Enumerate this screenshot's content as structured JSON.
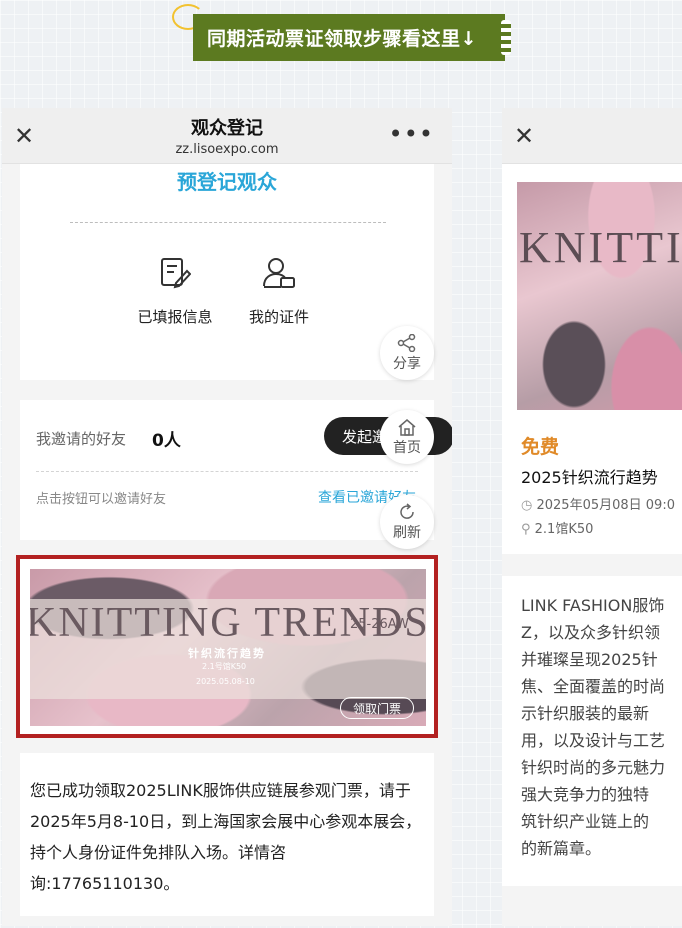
{
  "banner": {
    "text": "同期活动票证领取步骤看这里↓"
  },
  "left_panel": {
    "header": {
      "close": "✕",
      "title": "观众登记",
      "url": "zz.lisoexpo.com",
      "more": "•••"
    },
    "prereg_title": "预登记观众",
    "services": [
      {
        "label": "已填报信息",
        "icon": "form-edit-icon"
      },
      {
        "label": "我的证件",
        "icon": "id-card-icon"
      }
    ],
    "invite": {
      "label": "我邀请的好友",
      "count": "0人",
      "button": "发起邀请",
      "hint": "点击按钮可以邀请好友",
      "link": "查看已邀请好友"
    },
    "float_buttons": [
      {
        "label": "分享",
        "icon": "share-icon"
      },
      {
        "label": "首页",
        "icon": "home-icon"
      },
      {
        "label": "刷新",
        "icon": "refresh-icon"
      }
    ],
    "ticket": {
      "title": "KNITTING TRENDS",
      "season": "25-26AW",
      "cn_title": "针织流行趋势",
      "hall": "2.1号馆K50",
      "date": "2025.05.08-10",
      "button": "领取门票"
    },
    "notice": "您已成功领取2025LINK服饰供应链展参观门票，请于2025年5月8-10日，到上海国家会展中心参观本展会，持个人身份证件免排队入场。详情咨询:17765110130。"
  },
  "right_panel": {
    "header": {
      "close": "✕"
    },
    "image_title": "KNITTIN",
    "price": "免费",
    "event_name": "2025针织流行趋势",
    "date": "2025年05月08日 09:0",
    "location": "2.1馆K50",
    "description": [
      "LINK FASHION服饰",
      "Z，以及众多针织领",
      "并璀璨呈现2025针",
      "焦、全面覆盖的时尚",
      "示针织服装的最新",
      "用，以及设计与工艺",
      "针织时尚的多元魅力",
      "强大竞争力的独特",
      "筑针织产业链上的",
      "的新篇章。"
    ]
  },
  "colors": {
    "banner": "#5c7a20",
    "accent_blue": "#2aa6d8",
    "ticket_border": "#b32121",
    "price_orange": "#e08a28"
  }
}
